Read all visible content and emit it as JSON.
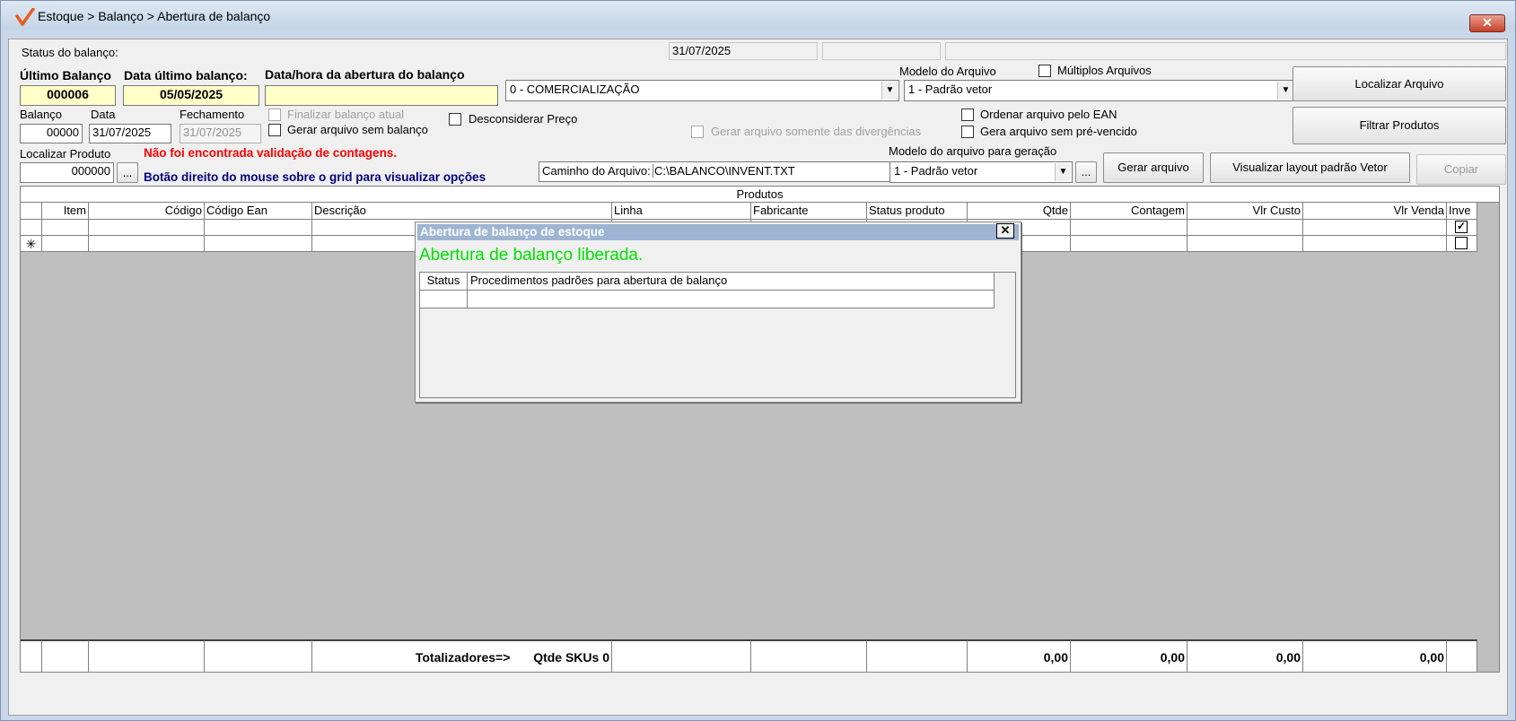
{
  "window": {
    "title": "Estoque > Balanço > Abertura de balanço",
    "close_label": "✕"
  },
  "status": {
    "label": "Status do balanço:",
    "date": "31/07/2025",
    "cell2": "",
    "cell3": ""
  },
  "ultimo_balanco": {
    "label": "Último Balanço",
    "value": "000006"
  },
  "data_ultimo_balanco": {
    "label": "Data último balanço:",
    "value": "05/05/2025"
  },
  "data_abertura": {
    "label": "Data/hora da abertura do balanço",
    "value": ""
  },
  "tipo": {
    "selected": "0 - COMERCIALIZAÇÃO"
  },
  "modelo_arquivo": {
    "label": "Modelo do Arquivo",
    "selected": "1 - Padrão vetor"
  },
  "multiplos_arquivos": {
    "label": "Múltiplos Arquivos",
    "checked": false
  },
  "buttons": {
    "localizar_arquivo": "Localizar Arquivo",
    "filtrar_produtos": "Filtrar Produtos",
    "gerar_arquivo": "Gerar arquivo",
    "visualizar_layout": "Visualizar layout padrão Vetor",
    "copiar": "Copiar",
    "browse_dots": "...",
    "produto_dots": "..."
  },
  "balanco": {
    "label": "Balanço",
    "value": "00000"
  },
  "data": {
    "label": "Data",
    "value": "31/07/2025"
  },
  "fechamento": {
    "label": "Fechamento",
    "value": "31/07/2025"
  },
  "options": {
    "finalizar_balanco": "Finalizar balanço atual",
    "gerar_sem_balanco": "Gerar arquivo sem balanço",
    "desconsiderar_preco": "Desconsiderar Preço",
    "somente_divergencias": "Gerar arquivo somente das divergências",
    "ordenar_ean": "Ordenar arquivo pelo EAN",
    "sem_pre_vencido": "Gera arquivo sem pré-vencido"
  },
  "localizar_produto": {
    "label": "Localizar Produto",
    "value": "000000"
  },
  "messages": {
    "validacao": "Não foi encontrada validação de contagens.",
    "dica_grid": "Botão direito do mouse sobre o grid para visualizar opções"
  },
  "caminho": {
    "label": "Caminho do Arquivo:",
    "value": "C:\\BALANCO\\INVENT.TXT"
  },
  "modelo_geracao": {
    "label": "Modelo do arquivo para geração",
    "selected": "1 - Padrão vetor"
  },
  "grid": {
    "caption": "Produtos",
    "columns": [
      "Item",
      "Código",
      "Código Ean",
      "Descrição",
      "Linha",
      "Fabricante",
      "Status produto",
      "Qtde",
      "Contagem",
      "Vlr Custo",
      "Vlr Venda",
      "Inve"
    ],
    "new_row_marker": "✳",
    "checkbox_checked": "✓",
    "footer": {
      "totalizadores": "Totalizadores=>",
      "qtde_skus": "Qtde SKUs 0",
      "qtde": "0,00",
      "contagem": "0,00",
      "vlr_custo": "0,00",
      "vlr_venda": "0,00"
    }
  },
  "dialog": {
    "title": "Abertura de balanço de estoque",
    "close_label": "✕",
    "message": "Abertura de balanço liberada.",
    "columns": [
      "Status",
      "Procedimentos padrões para abertura de balanço"
    ]
  },
  "colors": {
    "accent_red": "#ff0000",
    "accent_blue": "#000080",
    "success_green": "#00e000",
    "highlight_yellow": "#ffffc8"
  }
}
